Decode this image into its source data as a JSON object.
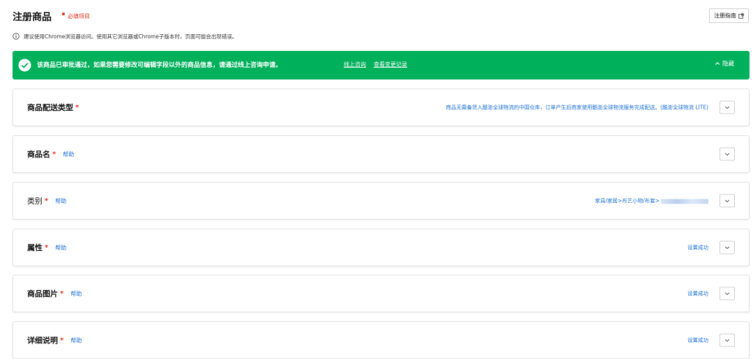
{
  "header": {
    "title": "注册商品",
    "required_note": "必填项目",
    "guide_button": "注册指南"
  },
  "notice": {
    "text": "建议使用Chrome浏览器访问。使用其它浏览器或Chrome子版本时，页面可能会出现错误。"
  },
  "banner": {
    "message": "该商品已审批通过，如果您需要修改可编辑字段以外的商品信息，请通过线上咨询申请。",
    "link_consult": "线上咨询",
    "link_history": "查看变更记录",
    "hide_label": "隐藏",
    "color": "#00b05a"
  },
  "sections": [
    {
      "title": "商品配送类型",
      "star": "*",
      "help": "",
      "value": "商品无需备货入酷澎全球物流的中国仓库，订单产生后商家使用酷澎全球物流服务完成配送。(酷澎全球物流 LITE)"
    },
    {
      "title": "商品名",
      "star": "*",
      "help": "帮助",
      "value": ""
    },
    {
      "title": "类别",
      "star": "*",
      "help": "帮助",
      "value": "家具/家居>布艺小物/布套>"
    },
    {
      "title": "属性",
      "star": "*",
      "help": "帮助",
      "value": "设置成功"
    },
    {
      "title": "商品图片",
      "star": "*",
      "help": "帮助",
      "value": "设置成功"
    },
    {
      "title": "详细说明",
      "star": "*",
      "help": "帮助",
      "value": "设置成功"
    }
  ],
  "colors": {
    "required": "#e0301e",
    "link": "#1a6fd6"
  }
}
